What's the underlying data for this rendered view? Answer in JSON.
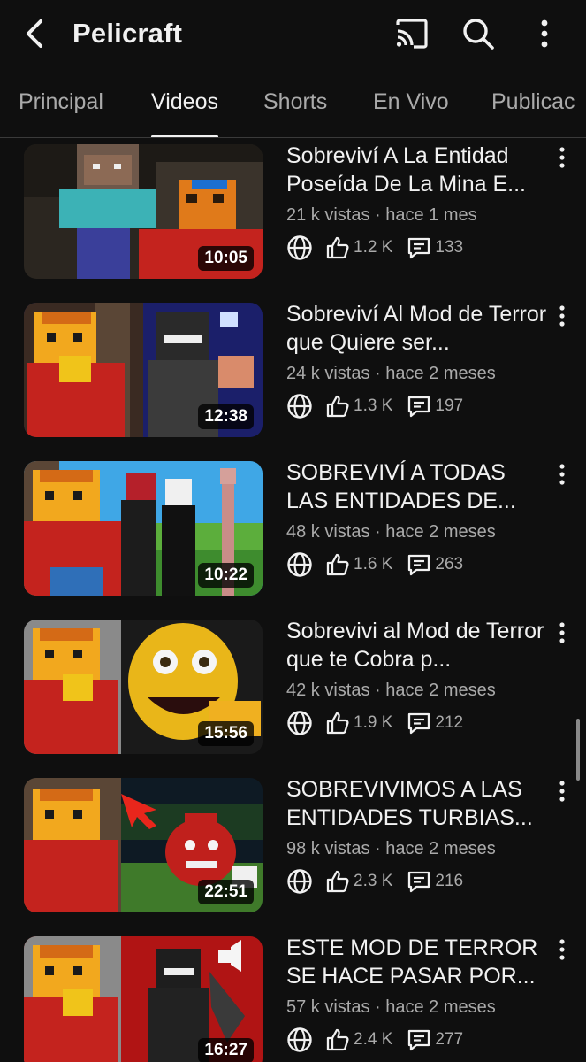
{
  "header": {
    "title": "Pelicraft",
    "back_icon": "back-arrow-icon",
    "cast_icon": "cast-icon",
    "search_icon": "search-icon",
    "more_icon": "more-vertical-icon"
  },
  "tabs": [
    {
      "label": "Principal",
      "active": false
    },
    {
      "label": "Videos",
      "active": true
    },
    {
      "label": "Shorts",
      "active": false
    },
    {
      "label": "En Vivo",
      "active": false
    },
    {
      "label": "Publicac",
      "active": false
    }
  ],
  "videos": [
    {
      "title": "Sobreviví A La Entidad Poseída De La Mina E...",
      "meta": "21 k vistas · hace 1 mes",
      "likes": "1.2 K",
      "comments": "133",
      "duration": "10:05"
    },
    {
      "title": "Sobreviví Al Mod de Terror que Quiere ser...",
      "meta": "24 k vistas · hace 2 meses",
      "likes": "1.3 K",
      "comments": "197",
      "duration": "12:38"
    },
    {
      "title": "SOBREVIVÍ A TODAS LAS ENTIDADES DE...",
      "meta": "48 k vistas · hace 2 meses",
      "likes": "1.6 K",
      "comments": "263",
      "duration": "10:22"
    },
    {
      "title": "Sobrevivi al Mod de Terror que te Cobra p...",
      "meta": "42 k vistas · hace 2 meses",
      "likes": "1.9 K",
      "comments": "212",
      "duration": "15:56"
    },
    {
      "title": "SOBREVIVIMOS A LAS ENTIDADES TURBIAS...",
      "meta": "98 k vistas · hace 2 meses",
      "likes": "2.3 K",
      "comments": "216",
      "duration": "22:51"
    },
    {
      "title": "ESTE MOD DE TERROR SE HACE PASAR POR...",
      "meta": "57 k vistas · hace 2 meses",
      "likes": "2.4 K",
      "comments": "277",
      "duration": "16:27"
    }
  ],
  "colors": {
    "background": "#0f0f0f",
    "text": "#f1f1f1",
    "secondary_text": "#aaaaaa"
  }
}
